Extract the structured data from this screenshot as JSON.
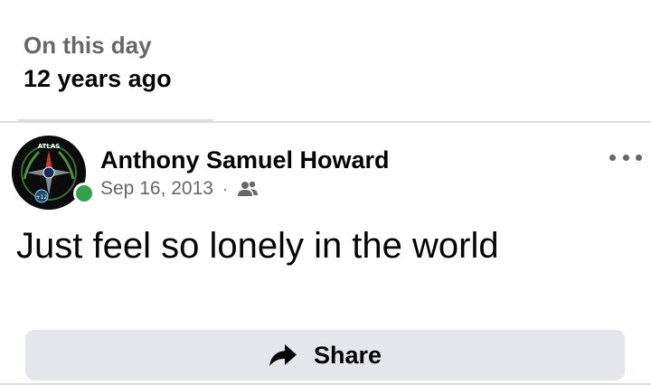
{
  "memory": {
    "kicker": "On this day",
    "years_ago": "12 years ago"
  },
  "post": {
    "author": "Anthony Samuel Howard",
    "date": "Sep 16, 2013",
    "separator": "·",
    "audience_icon": "friends-icon",
    "text": "Just feel so lonely in the world",
    "avatar_text": "ATLAS",
    "avatar_badge": "+12"
  },
  "actions": {
    "share_label": "Share",
    "share_icon": "share-arrow-icon",
    "more_icon": "more-options-icon"
  },
  "colors": {
    "online": "#31a24c",
    "secondary_text": "#65676b",
    "button_bg": "#e4e6eb"
  }
}
